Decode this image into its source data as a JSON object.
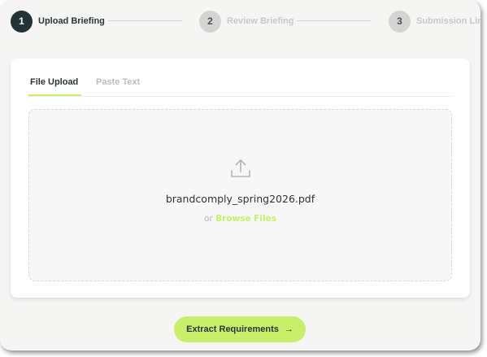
{
  "stepper": {
    "steps": [
      {
        "number": "1",
        "label": "Upload Briefing",
        "state": "active"
      },
      {
        "number": "2",
        "label": "Review Briefing",
        "state": "inactive"
      },
      {
        "number": "3",
        "label": "Submission Link",
        "state": "inactive"
      }
    ]
  },
  "tabs": [
    {
      "label": "File Upload",
      "state": "active"
    },
    {
      "label": "Paste Text",
      "state": "inactive"
    }
  ],
  "dropzone": {
    "icon": "upload-icon",
    "file_name": "brandcomply_spring2026.pdf",
    "or_text": "or",
    "browse_label": "Browse Files"
  },
  "cta": {
    "label": "Extract Requirements",
    "icon": "arrow-right-icon"
  },
  "colors": {
    "accent": "#c8ef6a",
    "dark": "#243335",
    "inactive_step": "#d4d4d3"
  }
}
